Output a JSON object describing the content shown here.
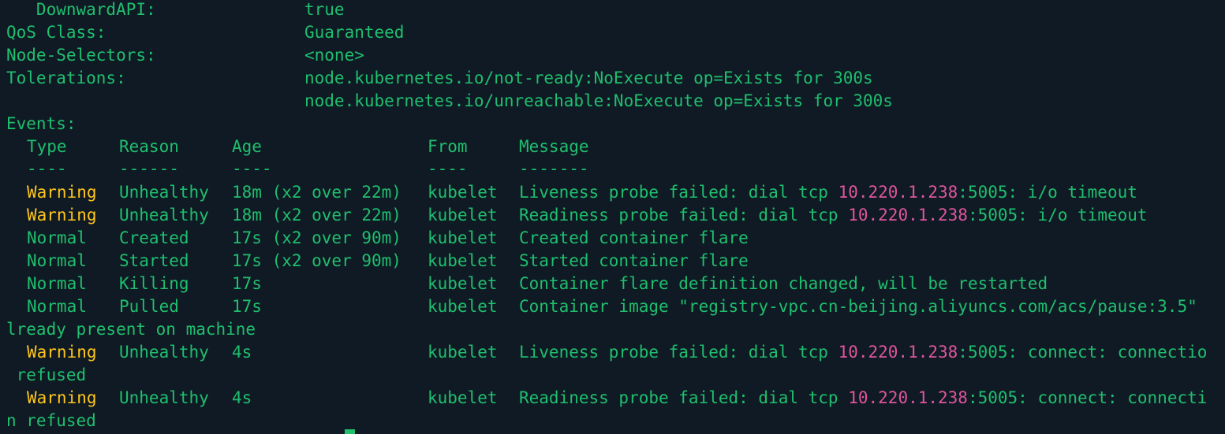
{
  "fields": [
    {
      "label": "   DownwardAPI:",
      "value": "true"
    },
    {
      "label": "QoS Class:",
      "value": "Guaranteed"
    },
    {
      "label": "Node-Selectors:",
      "value": "<none>"
    },
    {
      "label": "Tolerations:",
      "value": "node.kubernetes.io/not-ready:NoExecute op=Exists for 300s"
    },
    {
      "label": "",
      "value": "node.kubernetes.io/unreachable:NoExecute op=Exists for 300s"
    }
  ],
  "events": {
    "title": "Events:",
    "headers": {
      "type": "Type",
      "reason": "Reason",
      "age": "Age",
      "from": "From",
      "message": "Message"
    },
    "separators": {
      "type": "----",
      "reason": "------",
      "age": "----",
      "from": "----",
      "message": "-------"
    },
    "rows": [
      {
        "type": "Warning",
        "reason": "Unhealthy",
        "age": "18m (x2 over 22m)",
        "from": "kubelet",
        "msg_pre": "Liveness probe failed: dial tcp ",
        "ip": "10.220.1.238",
        "msg_post": ":5005: i/o timeout",
        "wrap": ""
      },
      {
        "type": "Warning",
        "reason": "Unhealthy",
        "age": "18m (x2 over 22m)",
        "from": "kubelet",
        "msg_pre": "Readiness probe failed: dial tcp ",
        "ip": "10.220.1.238",
        "msg_post": ":5005: i/o timeout",
        "wrap": ""
      },
      {
        "type": "Normal",
        "reason": "Created",
        "age": "17s (x2 over 90m)",
        "from": "kubelet",
        "msg_pre": "Created container flare",
        "ip": "",
        "msg_post": "",
        "wrap": ""
      },
      {
        "type": "Normal",
        "reason": "Started",
        "age": "17s (x2 over 90m)",
        "from": "kubelet",
        "msg_pre": "Started container flare",
        "ip": "",
        "msg_post": "",
        "wrap": ""
      },
      {
        "type": "Normal",
        "reason": "Killing",
        "age": "17s",
        "from": "kubelet",
        "msg_pre": "Container flare definition changed, will be restarted",
        "ip": "",
        "msg_post": "",
        "wrap": ""
      },
      {
        "type": "Normal",
        "reason": "Pulled",
        "age": "17s",
        "from": "kubelet",
        "msg_pre": "Container image \"registry-vpc.cn-beijing.aliyuncs.com/acs/pause:3.5\"",
        "ip": "",
        "msg_post": "",
        "wrap": "lready present on machine"
      },
      {
        "type": "Warning",
        "reason": "Unhealthy",
        "age": "4s",
        "from": "kubelet",
        "msg_pre": "Liveness probe failed: dial tcp ",
        "ip": "10.220.1.238",
        "msg_post": ":5005: connect: connectio",
        "wrap": " refused"
      },
      {
        "type": "Warning",
        "reason": "Unhealthy",
        "age": "4s",
        "from": "kubelet",
        "msg_pre": "Readiness probe failed: dial tcp ",
        "ip": "10.220.1.238",
        "msg_post": ":5005: connect: connecti",
        "wrap": "n refused"
      }
    ]
  },
  "colors": {
    "background": "#0f1a24",
    "text": "#1fbf6e",
    "warning": "#ffc61a",
    "ip": "#e0559d"
  }
}
